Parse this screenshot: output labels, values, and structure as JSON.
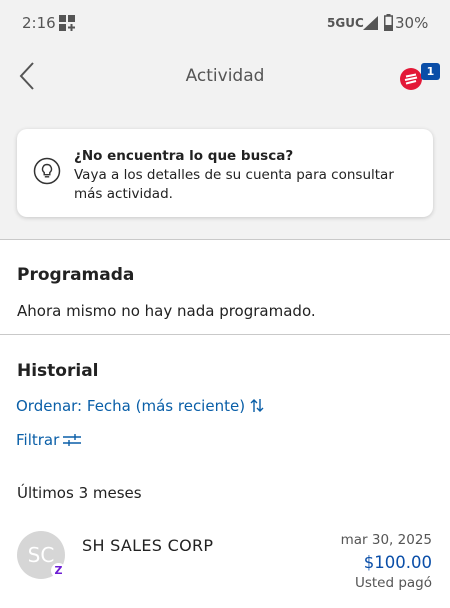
{
  "status_bar": {
    "time": "2:16",
    "network": "5GUC",
    "battery": "30%"
  },
  "header": {
    "title": "Actividad",
    "notification_count": "1"
  },
  "hint": {
    "title": "¿No encuentra lo que busca?",
    "body": "Vaya a los detalles de su cuenta para consultar más actividad."
  },
  "scheduled": {
    "title": "Programada",
    "message": "Ahora mismo no hay nada programado."
  },
  "history": {
    "title": "Historial",
    "sort_label": "Ordenar: Fecha (más reciente)",
    "filter_label": "Filtrar",
    "period_label": "Últimos 3 meses",
    "transactions": [
      {
        "initials": "SC",
        "name": "SH SALES CORP",
        "date": "mar 30, 2025",
        "amount": "$100.00",
        "status": "Usted pagó",
        "badge": "Z"
      }
    ]
  },
  "colors": {
    "accent": "#0a5fa8",
    "brand_red": "#e31837",
    "zelle": "#6d1ed4"
  },
  "icons": [
    "grid-icon",
    "signal-icon",
    "battery-icon",
    "back-icon",
    "bank-logo-icon",
    "lightbulb-icon",
    "sort-icon",
    "filter-icon",
    "zelle-icon"
  ]
}
